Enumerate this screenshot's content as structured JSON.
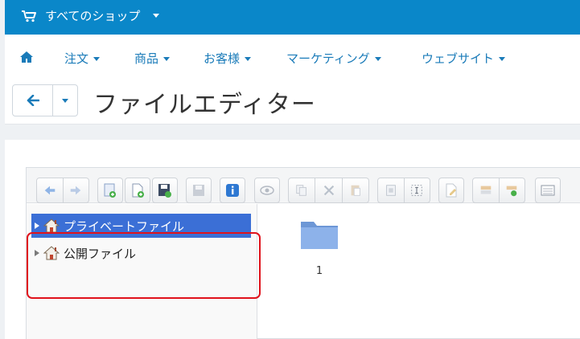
{
  "topbar": {
    "shop_label": "すべてのショップ",
    "icon": "cart-icon"
  },
  "nav": {
    "home_icon": "home-icon",
    "items": [
      "注文",
      "商品",
      "お客様",
      "マーケティング",
      "ウェブサイト"
    ]
  },
  "page": {
    "title": "ファイルエディター"
  },
  "toolbar": {
    "buttons": [
      "back",
      "forward",
      "upload",
      "new-file",
      "save-as",
      "save",
      "info",
      "view",
      "copy",
      "cut",
      "paste",
      "duplicate",
      "select",
      "edit",
      "resize",
      "extract",
      "list-view"
    ]
  },
  "tree": {
    "items": [
      {
        "label": "プライベートファイル",
        "selected": true
      },
      {
        "label": "公開ファイル",
        "selected": false
      }
    ]
  },
  "files": {
    "items": [
      {
        "name": "1",
        "type": "folder"
      }
    ]
  },
  "colors": {
    "topbar": "#0a87c9",
    "link": "#1a7bb9",
    "selection": "#3b6fd6",
    "highlight": "#e0121b"
  }
}
